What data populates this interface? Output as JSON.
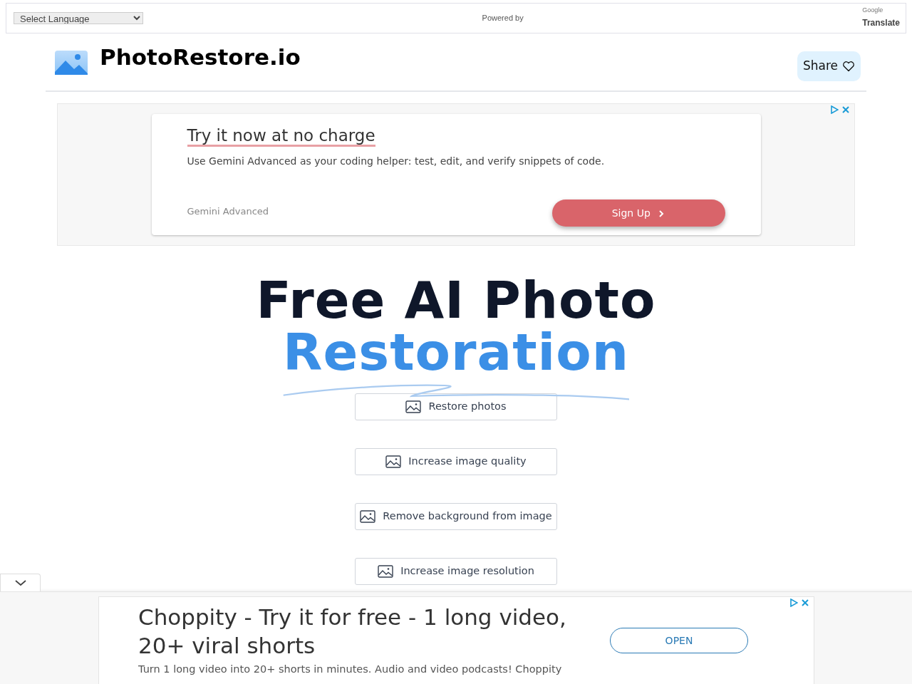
{
  "translate_bar": {
    "language_select": "Select Language",
    "powered_by": "Powered by",
    "google": "Google",
    "translate": "Translate"
  },
  "header": {
    "site_name": "PhotoRestore.io",
    "share_button": "Share"
  },
  "top_ad": {
    "headline": "Try it now at no charge",
    "body": "Use Gemini Advanced as your coding helper: test, edit, and verify snippets of code.",
    "advertiser": "Gemini Advanced",
    "cta": "Sign Up"
  },
  "hero": {
    "title_line_1": "Free AI Photo",
    "title_line_2": "Restoration"
  },
  "tool_buttons": [
    {
      "label": "Restore photos"
    },
    {
      "label": "Increase image quality"
    },
    {
      "label": "Remove background from image"
    },
    {
      "label": "Increase image resolution"
    }
  ],
  "bottom_ad": {
    "headline": "Choppity - Try it for free - 1 long video, 20+ viral shorts",
    "body": "Turn 1 long video into 20+ shorts in minutes. Audio and video podcasts! Choppity",
    "cta": "OPEN"
  }
}
